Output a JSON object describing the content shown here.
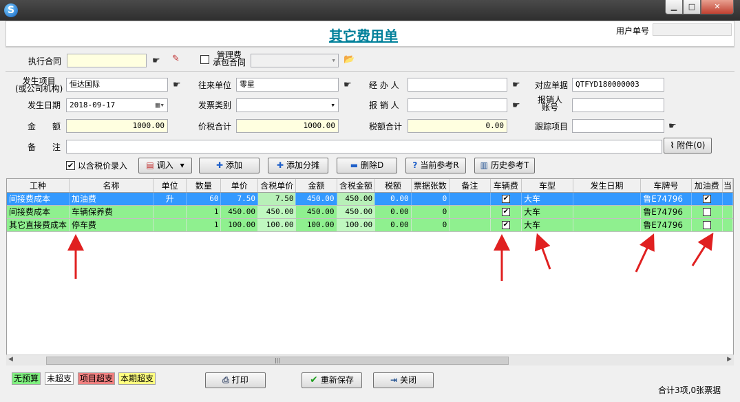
{
  "title": "其它费用单",
  "user_no": {
    "label": "用户单号",
    "value": ""
  },
  "contract": {
    "label": "执行合同",
    "value": "",
    "mgmt_checkbox_label_1": "管理费",
    "mgmt_checkbox_label_2": "承包合同",
    "mgmt_checked": false
  },
  "form": {
    "item_label_1": "发生项目",
    "item_label_2": "(或公司机构)",
    "item_value": "恒达国际",
    "partner_label": "往来单位",
    "partner_value": "零星",
    "handler_label": "经 办 人",
    "handler_value": "",
    "ref_doc_label": "对应单据",
    "ref_doc_value": "QTFYD180000003",
    "date_label": "发生日期",
    "date_value": "2018-09-17",
    "invoice_type_label": "发票类别",
    "invoice_type_value": "",
    "reimburser_label": "报 销 人",
    "reimburser_value": "",
    "reimb_account_label_1": "报销人",
    "reimb_account_label_2": "账号",
    "reimb_account_value": "",
    "amount_label": "金　　额",
    "amount_value": "1000.00",
    "total_tax_label": "价税合计",
    "total_tax_value": "1000.00",
    "tax_total_label": "税额合计",
    "tax_total_value": "0.00",
    "track_label": "跟踪项目",
    "track_value": "",
    "remark_label": "备　　注",
    "remark_value": ""
  },
  "toolbar": {
    "include_tax_label": "以含税价录入",
    "include_tax_checked": true,
    "import_label": "调入",
    "add_label": "添加",
    "add_split_label": "添加分摊",
    "delete_label": "删除D",
    "current_ref_label": "当前参考R",
    "history_ref_label": "历史参考T",
    "attach_label": "附件(0)"
  },
  "grid": {
    "columns": [
      "工种",
      "名称",
      "单位",
      "数量",
      "单价",
      "含税单价",
      "金额",
      "含税金额",
      "税额",
      "票据张数",
      "备注",
      "车辆费",
      "车型",
      "发生日期",
      "车牌号",
      "加油费",
      "当"
    ],
    "rows": [
      {
        "type": "间接费成本",
        "name": "加油费",
        "unit": "升",
        "qty": "60",
        "price": "7.50",
        "tax_price": "7.50",
        "amount": "450.00",
        "tax_amount": "450.00",
        "tax": "0.00",
        "tickets": "0",
        "remark": "",
        "vehicle_fee": true,
        "car_type": "大车",
        "date": "",
        "plate": "鲁E74796",
        "fuel_fee": true
      },
      {
        "type": "间接费成本",
        "name": "车辆保养费",
        "unit": "",
        "qty": "1",
        "price": "450.00",
        "tax_price": "450.00",
        "amount": "450.00",
        "tax_amount": "450.00",
        "tax": "0.00",
        "tickets": "0",
        "remark": "",
        "vehicle_fee": true,
        "car_type": "大车",
        "date": "",
        "plate": "鲁E74796",
        "fuel_fee": false
      },
      {
        "type": "其它直接费成本",
        "name": "停车费",
        "unit": "",
        "qty": "1",
        "price": "100.00",
        "tax_price": "100.00",
        "amount": "100.00",
        "tax_amount": "100.00",
        "tax": "0.00",
        "tickets": "0",
        "remark": "",
        "vehicle_fee": true,
        "car_type": "大车",
        "date": "",
        "plate": "鲁E74796",
        "fuel_fee": false
      }
    ]
  },
  "legend": {
    "no_budget": "无预算",
    "not_over": "未超支",
    "item_over": "项目超支",
    "period_over": "本期超支"
  },
  "buttons": {
    "print": "打印",
    "resave": "重新保存",
    "close": "关闭"
  },
  "footer": {
    "summary": "合计3项,0张票据"
  },
  "colors": {
    "title": "#00809a",
    "selected_row": "#3399ff",
    "green_row": "#8ff08f",
    "legend_no_budget": "#80f080",
    "legend_item_over": "#f08080",
    "legend_period_over": "#ffff80",
    "arrow": "#e02020"
  }
}
